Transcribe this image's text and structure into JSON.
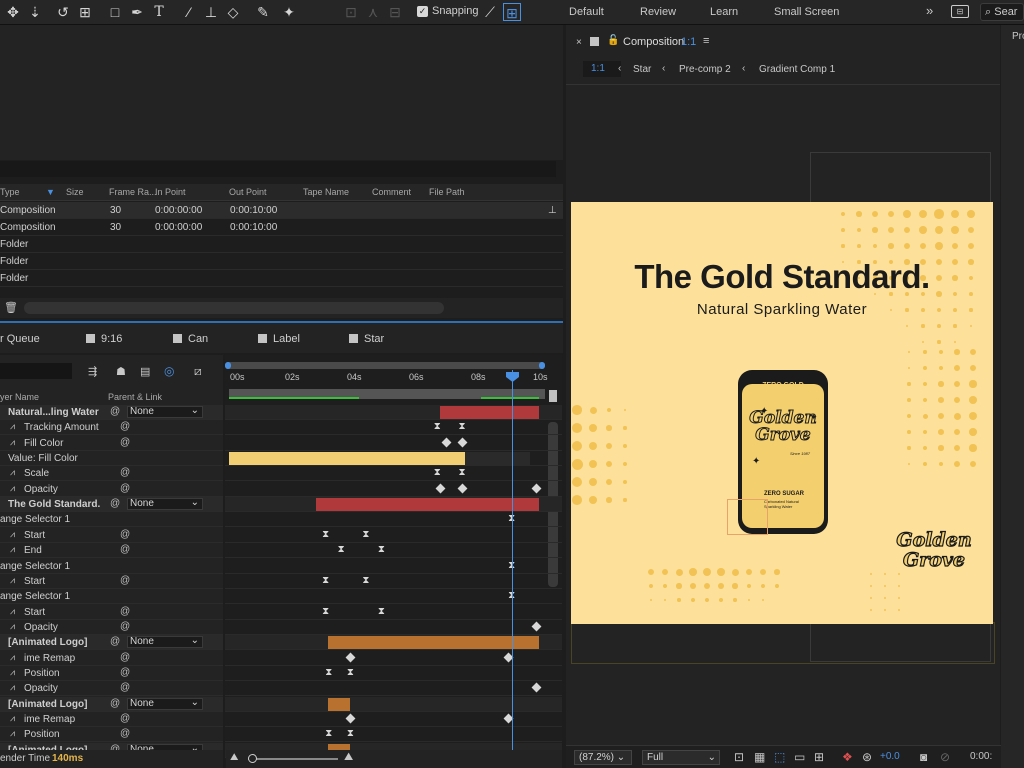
{
  "toolbar": {
    "snapping_label": "Snapping",
    "workspaces": [
      "Default",
      "Review",
      "Learn",
      "Small Screen"
    ],
    "search_placeholder": "Sear",
    "tool_icons": [
      "hand-icon",
      "zoom-icon",
      "rotate-icon",
      "camera-icon",
      "rectangle-icon",
      "pen-icon",
      "type-icon",
      "brush-icon",
      "clone-stamp-icon",
      "eraser-icon",
      "roto-brush-icon",
      "puppet-pin-icon"
    ]
  },
  "project": {
    "columns": [
      "Type",
      "Size",
      "Frame Ra...",
      "In Point",
      "Out Point",
      "Tape Name",
      "Comment",
      "File Path"
    ],
    "rows": [
      {
        "type": "Composition",
        "frame_rate": "30",
        "in_point": "0:00:00:00",
        "out_point": "0:00:10:00"
      },
      {
        "type": "Composition",
        "frame_rate": "30",
        "in_point": "0:00:00:00",
        "out_point": "0:00:10:00"
      },
      {
        "type": "Folder",
        "frame_rate": "",
        "in_point": "",
        "out_point": ""
      },
      {
        "type": "Folder",
        "frame_rate": "",
        "in_point": "",
        "out_point": ""
      },
      {
        "type": "Folder",
        "frame_rate": "",
        "in_point": "",
        "out_point": ""
      }
    ]
  },
  "timeline_tabs": [
    "r Queue",
    "9:16",
    "Can",
    "Label",
    "Star"
  ],
  "timeline": {
    "col_layer_name": "yer Name",
    "col_parent": "Parent & Link",
    "ruler_labels": [
      "00s",
      "02s",
      "04s",
      "06s",
      "08s",
      "10s"
    ],
    "rows": [
      {
        "label": "Natural...ling Water",
        "kind": "layer",
        "parent": "None"
      },
      {
        "label": "Tracking Amount",
        "kind": "prop"
      },
      {
        "label": "Fill Color",
        "kind": "prop"
      },
      {
        "label": "Value: Fill Color",
        "kind": "value"
      },
      {
        "label": "Scale",
        "kind": "prop"
      },
      {
        "label": "Opacity",
        "kind": "prop"
      },
      {
        "label": "The Gold Standard.",
        "kind": "layer",
        "parent": "None"
      },
      {
        "label": "ange Selector 1",
        "kind": "group"
      },
      {
        "label": "Start",
        "kind": "prop"
      },
      {
        "label": "End",
        "kind": "prop"
      },
      {
        "label": "ange Selector 1",
        "kind": "group"
      },
      {
        "label": "Start",
        "kind": "prop"
      },
      {
        "label": "ange Selector 1",
        "kind": "group"
      },
      {
        "label": "Start",
        "kind": "prop"
      },
      {
        "label": "Opacity",
        "kind": "prop"
      },
      {
        "label": "[Animated Logo]",
        "kind": "layer",
        "parent": "None"
      },
      {
        "label": "ime Remap",
        "kind": "prop"
      },
      {
        "label": "Position",
        "kind": "prop"
      },
      {
        "label": "Opacity",
        "kind": "prop"
      },
      {
        "label": "[Animated Logo]",
        "kind": "layer",
        "parent": "None"
      },
      {
        "label": "ime Remap",
        "kind": "prop"
      },
      {
        "label": "Position",
        "kind": "prop"
      },
      {
        "label": "[Animated Logo]",
        "kind": "layer",
        "parent": "None"
      }
    ],
    "render_time_label": "ender Time",
    "render_time_value": "140ms"
  },
  "viewer": {
    "tab_label": "Composition",
    "tab_ratio": "1:1",
    "breadcrumb_ratio": "1:1",
    "breadcrumbs": [
      "Star",
      "Pre-comp 2",
      "Gradient Comp 1"
    ],
    "headline": "The Gold Standard.",
    "subhead": "Natural Sparkling Water",
    "can_top": "ZERO GOLD",
    "can_logo_1": "Golden",
    "can_logo_2": "Grove",
    "can_since": "Since 1987",
    "can_zero_sugar": "ZERO SUGAR",
    "can_desc_1": "Carbonated Natural",
    "can_desc_2": "Sparkling Water",
    "corner_logo_1": "Golden",
    "corner_logo_2": "Grove",
    "zoom": "(87.2%)",
    "resolution": "Full",
    "exposure": "+0.0",
    "timecode": "0:00:"
  },
  "right_panel_label": "Pro",
  "colors": {
    "accent_blue": "#4a90e2",
    "bar_red": "#b0393b",
    "bar_orange": "#b8712e",
    "comp_bg": "#fde19a",
    "dots": "#f2c354"
  }
}
